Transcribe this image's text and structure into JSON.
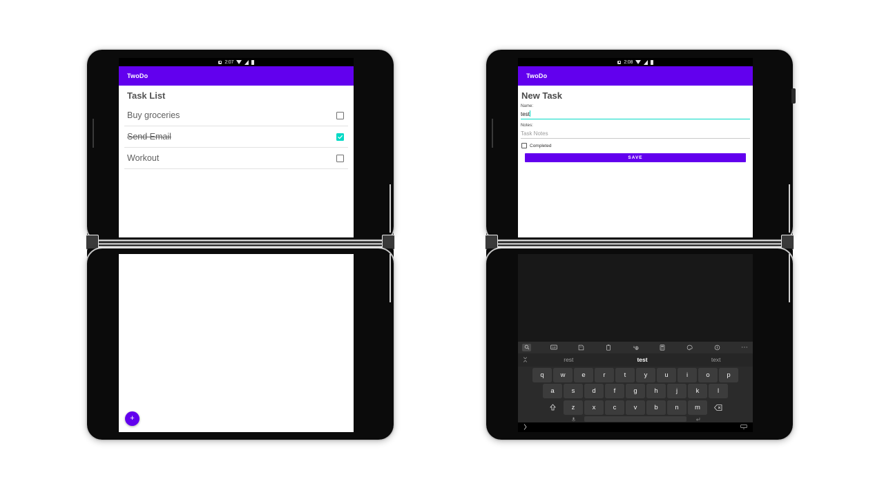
{
  "app": {
    "name": "TwoDo",
    "brand_color": "#6200EE",
    "accent_color": "#03DAC5"
  },
  "left_device": {
    "label": "surface-duo-task-list",
    "status_bar": {
      "time": "2:07",
      "icons": [
        "app-notification-icon",
        "wifi-icon",
        "signal-icon",
        "battery-icon"
      ]
    },
    "app_bar": {
      "title": "TwoDo"
    },
    "screen_title": "Task List",
    "tasks": [
      {
        "name": "Buy groceries",
        "completed": false
      },
      {
        "name": "Send Email",
        "completed": true
      },
      {
        "name": "Workout",
        "completed": false
      }
    ],
    "fab": {
      "label": "+",
      "name": "add-task-fab"
    },
    "bottom_screen": {
      "content": ""
    }
  },
  "right_device": {
    "label": "surface-duo-new-task",
    "status_bar": {
      "time": "2:08",
      "icons": [
        "app-notification-icon",
        "wifi-icon",
        "signal-icon",
        "battery-icon"
      ]
    },
    "app_bar": {
      "title": "TwoDo"
    },
    "screen_title": "New Task",
    "form": {
      "name_label": "Name:",
      "name_value": "test",
      "notes_label": "Notes:",
      "notes_placeholder": "Task Notes",
      "completed_label": "Completed",
      "completed_checked": false,
      "save_label": "SAVE"
    },
    "keyboard": {
      "toolbar_icons": [
        "search-icon",
        "gif-icon",
        "sticker-icon",
        "clipboard-icon",
        "translate-icon",
        "calculator-icon",
        "theme-icon",
        "settings-icon",
        "more-icon"
      ],
      "suggestion_leading_icon": "expand-icon",
      "suggestions": [
        {
          "text": "rest",
          "active": false
        },
        {
          "text": "test",
          "active": true
        },
        {
          "text": "text",
          "active": false
        }
      ],
      "rows": [
        [
          "q",
          "w",
          "e",
          "r",
          "t",
          "y",
          "u",
          "i",
          "o",
          "p"
        ],
        [
          "a",
          "s",
          "d",
          "f",
          "g",
          "h",
          "j",
          "k",
          "l"
        ],
        [
          "z",
          "x",
          "c",
          "v",
          "b",
          "n",
          "m"
        ]
      ],
      "shift_key": "shift-key",
      "backspace_key": "backspace-key",
      "mic_key": "mic-key",
      "space_key": "space-key",
      "enter_key": "enter-key"
    },
    "nav_bar": {
      "back_icon": "back-chevron-icon",
      "dismiss_icon": "hide-keyboard-icon"
    }
  }
}
